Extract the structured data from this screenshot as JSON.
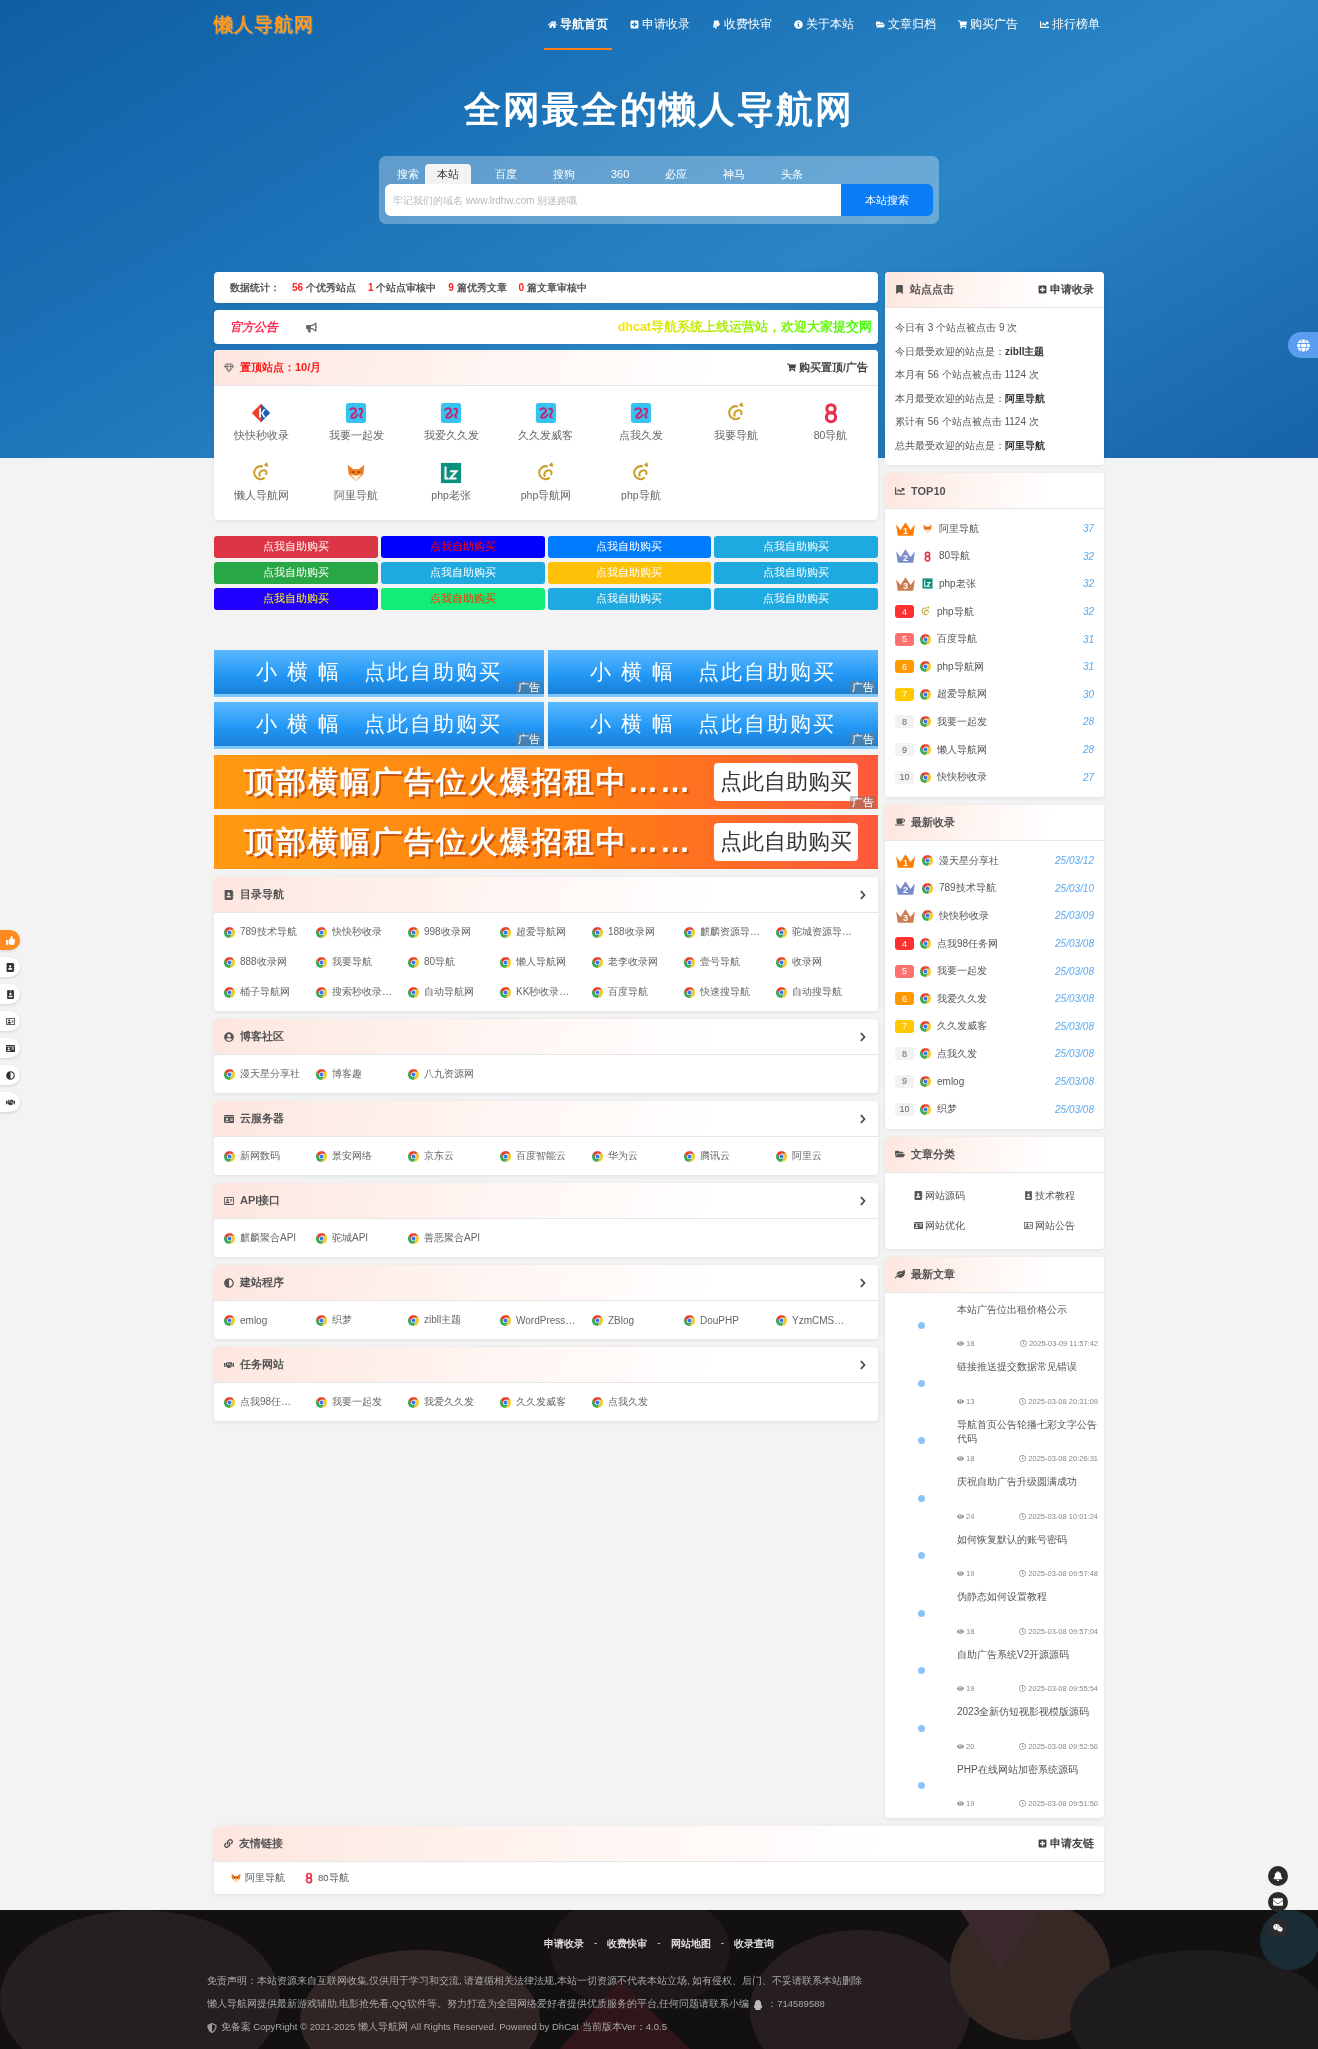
{
  "header": {
    "logo": "懒人导航网",
    "nav": [
      {
        "label": "导航首页",
        "selected": true
      },
      {
        "label": "申请收录",
        "selected": false
      },
      {
        "label": "收费快审",
        "selected": false
      },
      {
        "label": "关于本站",
        "selected": false
      },
      {
        "label": "文章归档",
        "selected": false
      },
      {
        "label": "购买广告",
        "selected": false
      },
      {
        "label": "排行榜单",
        "selected": false
      }
    ],
    "hero_title": "全网最全的懒人导航网",
    "search": {
      "label": "搜索",
      "tabs": [
        {
          "label": "本站",
          "selected": true
        },
        {
          "label": "百度",
          "selected": false
        },
        {
          "label": "搜狗",
          "selected": false
        },
        {
          "label": "360",
          "selected": false
        },
        {
          "label": "必应",
          "selected": false
        },
        {
          "label": "神马",
          "selected": false
        },
        {
          "label": "头条",
          "selected": false
        }
      ],
      "placeholder": "牢记我们的域名 www.lrdhw.com 别迷路哦",
      "button": "本站搜索"
    }
  },
  "stats": {
    "label": "数据统计：",
    "items": [
      {
        "count": "56",
        "text": "个优秀站点"
      },
      {
        "count": "1",
        "text": "个站点审核中"
      },
      {
        "count": "9",
        "text": "篇优秀文章"
      },
      {
        "count": "0",
        "text": "篇文章审核中"
      }
    ]
  },
  "announcement": {
    "title": "官方公告",
    "text": "dhcat导航系统上线运营站，欢迎大家提交网"
  },
  "top_sites": {
    "title": "置顶站点：10/月",
    "action": "购买置顶/广告",
    "sites": [
      {
        "name": "快快秒收录",
        "kind": "diamond"
      },
      {
        "name": "我要一起发",
        "kind": "wave"
      },
      {
        "name": "我爱久久发",
        "kind": "wave"
      },
      {
        "name": "久久发威客",
        "kind": "wave"
      },
      {
        "name": "点我久发",
        "kind": "wave"
      },
      {
        "name": "我要导航",
        "kind": "cat"
      },
      {
        "name": "80导航",
        "kind": "eight"
      },
      {
        "name": "懒人导航网",
        "kind": "cat"
      },
      {
        "name": "阿里导航",
        "kind": "fox"
      },
      {
        "name": "php老张",
        "kind": "lz"
      },
      {
        "name": "php导航网",
        "kind": "cat"
      },
      {
        "name": "php导航",
        "kind": "cat"
      }
    ]
  },
  "ad_buttons": [
    {
      "label": "点我自助购买",
      "color": "#dc3545",
      "kind": "plain"
    },
    {
      "label": "点我自助购买",
      "color": "#0000ff",
      "kind": "alert"
    },
    {
      "label": "点我自助购买",
      "color": "#007bff",
      "kind": "plain"
    },
    {
      "label": "点我自助购买",
      "color": "#1eaae1",
      "kind": "plain"
    },
    {
      "label": "点我自助购买",
      "color": "#28a745",
      "kind": "plain"
    },
    {
      "label": "点我自助购买",
      "color": "#1eaae1",
      "kind": "plain"
    },
    {
      "label": "点我自助购买",
      "color": "#ffc107",
      "kind": "plain"
    },
    {
      "label": "点我自助购买",
      "color": "#1eaae1",
      "kind": "plain"
    },
    {
      "label": "点我自助购买",
      "color": "#2200ff",
      "kind": "gold"
    },
    {
      "label": "点我自助购买",
      "color": "#11ee77",
      "kind": "orange"
    },
    {
      "label": "点我自助购买",
      "color": "#1eaae1",
      "kind": "plain"
    },
    {
      "label": "点我自助购买",
      "color": "#1eaae1",
      "kind": "plain"
    }
  ],
  "small_banners": [
    {
      "text": "小 横 幅　点此自助购买",
      "tag": "广告"
    },
    {
      "text": "小 横 幅　点此自助购买",
      "tag": "广告"
    },
    {
      "text": "小 横 幅　点此自助购买",
      "tag": "广告"
    },
    {
      "text": "小 横 幅　点此自助购买",
      "tag": "广告"
    }
  ],
  "big_banners": [
    {
      "text": "顶部横幅广告位火爆招租中……",
      "button": "点此自助购买",
      "tag": "广告"
    },
    {
      "text": "顶部横幅广告位火爆招租中……",
      "button": "点此自助购买"
    }
  ],
  "categories": [
    {
      "title": "目录导航",
      "sites": [
        "789技术导航",
        "快快秒收录",
        "998收录网",
        "超爱导航网",
        "188收录网",
        "麒麟资源导…",
        "驼城资源导…",
        "888收录网",
        "我要导航",
        "80导航",
        "懒人导航网",
        "老李收录网",
        "壹号导航",
        "收录网",
        "桶子导航网",
        "搜索秒收录…",
        "自动导航网",
        "KK秒收录…",
        "百度导航",
        "快速搜导航",
        "自动搜导航"
      ]
    },
    {
      "title": "博客社区",
      "sites": [
        "漫天星分享社",
        "博客趣",
        "八九资源网"
      ]
    },
    {
      "title": "云服务器",
      "sites": [
        "新网数码",
        "景安网络",
        "京东云",
        "百度智能云",
        "华为云",
        "腾讯云",
        "阿里云"
      ]
    },
    {
      "title": "API接口",
      "sites": [
        "麒麟聚合API",
        "驼城API",
        "善恶聚合API"
      ]
    },
    {
      "title": "建站程序",
      "sites": [
        "emlog",
        "织梦",
        "zibll主题",
        "WordPress…",
        "ZBlog",
        "DouPHP",
        "YzmCMS…"
      ]
    },
    {
      "title": "任务网站",
      "sites": [
        "点我98任…",
        "我要一起发",
        "我爱久久发",
        "久久发威客",
        "点我久发"
      ]
    }
  ],
  "sidebar": {
    "site_clicks": {
      "title": "站点点击",
      "action": "申请收录",
      "lines": [
        "今日有 3 个站点被点击 9 次",
        "今日最受欢迎的站点是：**zibll主题**",
        "本月有 56 个站点被点击 1124 次",
        "本月最受欢迎的站点是：**阿里导航**",
        "累计有 56 个站点被点击 1124 次",
        "总共最受欢迎的站点是：**阿里导航**"
      ]
    },
    "top10": {
      "title": "TOP10",
      "items": [
        {
          "rank": {
            "label": "1",
            "kind": "crown",
            "color": "#ff7d00"
          },
          "kind": "fox",
          "name": "阿里导航",
          "value": "37"
        },
        {
          "rank": {
            "label": "2",
            "kind": "crown",
            "color": "#7a8ccc"
          },
          "kind": "eight",
          "name": "80导航",
          "value": "32"
        },
        {
          "rank": {
            "label": "3",
            "kind": "crown",
            "color": "#d07a50"
          },
          "kind": "lz",
          "name": "php老张",
          "value": "32"
        },
        {
          "rank": {
            "label": "4",
            "kind": "badge",
            "color": "#ff3030"
          },
          "kind": "cat",
          "name": "php导航",
          "value": "32"
        },
        {
          "rank": {
            "label": "5",
            "kind": "badge",
            "color": "#ff7070"
          },
          "kind": "chrome",
          "name": "百度导航",
          "value": "31"
        },
        {
          "rank": {
            "label": "6",
            "kind": "badge",
            "color": "#ff9900"
          },
          "kind": "chrome",
          "name": "php导航网",
          "value": "31"
        },
        {
          "rank": {
            "label": "7",
            "kind": "badge",
            "color": "#ffc800"
          },
          "kind": "chrome",
          "name": "超爱导航网",
          "value": "30"
        },
        {
          "rank": {
            "label": "8",
            "kind": "badge",
            "color": "#f2f2f2"
          },
          "kind": "chrome",
          "name": "我要一起发",
          "value": "28"
        },
        {
          "rank": {
            "label": "9",
            "kind": "badge",
            "color": "#f2f2f2"
          },
          "kind": "chrome",
          "name": "懒人导航网",
          "value": "28"
        },
        {
          "rank": {
            "label": "10",
            "kind": "badge",
            "color": "#f2f2f2"
          },
          "kind": "chrome",
          "name": "快快秒收录",
          "value": "27"
        }
      ]
    },
    "newest": {
      "title": "最新收录",
      "items": [
        {
          "rank": {
            "label": "1",
            "kind": "crown",
            "color": "#ff7d00"
          },
          "kind": "chrome",
          "name": "漫天星分享社",
          "value": "25/03/12"
        },
        {
          "rank": {
            "label": "2",
            "kind": "crown",
            "color": "#7a8ccc"
          },
          "kind": "chrome",
          "name": "789技术导航",
          "value": "25/03/10"
        },
        {
          "rank": {
            "label": "3",
            "kind": "crown",
            "color": "#d07a50"
          },
          "kind": "chrome",
          "name": "快快秒收录",
          "value": "25/03/09"
        },
        {
          "rank": {
            "label": "4",
            "kind": "badge",
            "color": "#ff3030"
          },
          "kind": "chrome",
          "name": "点我98任务网",
          "value": "25/03/08"
        },
        {
          "rank": {
            "label": "5",
            "kind": "badge",
            "color": "#ff7070"
          },
          "kind": "chrome",
          "name": "我要一起发",
          "value": "25/03/08"
        },
        {
          "rank": {
            "label": "6",
            "kind": "badge",
            "color": "#ff9900"
          },
          "kind": "chrome",
          "name": "我爱久久发",
          "value": "25/03/08"
        },
        {
          "rank": {
            "label": "7",
            "kind": "badge",
            "color": "#ffc800"
          },
          "kind": "chrome",
          "name": "久久发威客",
          "value": "25/03/08"
        },
        {
          "rank": {
            "label": "8",
            "kind": "badge",
            "color": "#f2f2f2"
          },
          "kind": "chrome",
          "name": "点我久发",
          "value": "25/03/08"
        },
        {
          "rank": {
            "label": "9",
            "kind": "badge",
            "color": "#f2f2f2"
          },
          "kind": "chrome",
          "name": "emlog",
          "value": "25/03/08"
        },
        {
          "rank": {
            "label": "10",
            "kind": "badge",
            "color": "#f2f2f2"
          },
          "kind": "chrome",
          "name": "织梦",
          "value": "25/03/08"
        }
      ]
    },
    "article_categories": {
      "title": "文章分类",
      "items": [
        "网站源码",
        "技术教程",
        "网站优化",
        "网站公告"
      ]
    },
    "latest_articles": {
      "title": "最新文章",
      "items": [
        {
          "title": "本站广告位出租价格公示",
          "views": "18",
          "time": "2025-03-09 11:57:42"
        },
        {
          "title": "链接推送提交数据常见错误",
          "views": "13",
          "time": "2025-03-08 20:31:09"
        },
        {
          "title": "导航首页公告轮播七彩文字公告代码",
          "views": "18",
          "time": "2025-03-08 20:26:31"
        },
        {
          "title": "庆祝自助广告升级圆满成功",
          "views": "24",
          "time": "2025-03-08 10:01:24"
        },
        {
          "title": "如何恢复默认的账号密码",
          "views": "19",
          "time": "2025-03-08 09:57:48"
        },
        {
          "title": "伪静态如何设置教程",
          "views": "18",
          "time": "2025-03-08 09:57:04"
        },
        {
          "title": "自助广告系统V2开源源码",
          "views": "19",
          "time": "2025-03-08 09:55:54"
        },
        {
          "title": "2023全新仿短视影视模版源码",
          "views": "20",
          "time": "2025-03-08 09:52:56"
        },
        {
          "title": "PHP在线网站加密系统源码",
          "views": "19",
          "time": "2025-03-08 09:51:50"
        }
      ]
    }
  },
  "friend_links": {
    "title": "友情链接",
    "action": "申请友链",
    "links": [
      {
        "name": "阿里导航",
        "kind": "fox"
      },
      {
        "name": "80导航",
        "kind": "eight"
      }
    ]
  },
  "footer": {
    "links": [
      "申请收录",
      "收费快审",
      "网站地图",
      "收录查询"
    ],
    "separator": "-",
    "disclaimer": "免责声明：本站资源来自互联网收集,仅供用于学习和交流, 请遵循相关法律法规,本站一切资源不代表本站立场, 如有侵权、后门、不妥请联系本站删除",
    "about": "懒人导航网提供最新游戏辅助,电影抢先看,QQ软件等。努力打造为全国网络爱好者提供优质服务的平台,任何问题请联系小编",
    "qq": "：714589588",
    "copyright": "免备案 CopyRight © 2021-2025 懒人导航网 All Rights Reserved. Powered by DhCat 当前版本Ver：4.0.5"
  }
}
